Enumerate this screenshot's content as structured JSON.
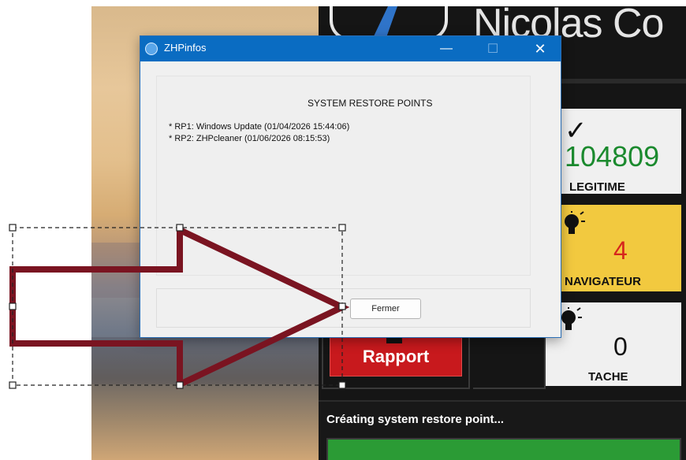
{
  "background_app": {
    "brand_text": "Nicolas Co",
    "tiles": [
      {
        "value": "104809",
        "label": "LEGITIME"
      },
      {
        "value": "4",
        "label": "NAVIGATEUR"
      },
      {
        "value": "0",
        "label": "TACHE"
      }
    ],
    "rapport_button": "Rapport",
    "status_text": "Créating system restore point...",
    "progress_fraction": 1.0,
    "colors": {
      "legit_green": "#1b8a2e",
      "nav_red": "#d6251c",
      "nav_tile": "#f2c93f",
      "rapport_red": "#c8191d",
      "progress_green": "#2b9b35"
    },
    "icons": [
      "check-icon",
      "bulb-icon",
      "bulb-icon"
    ]
  },
  "dialog": {
    "title": "ZHPinfos",
    "controls": {
      "minimize": "—",
      "maximize": "☐",
      "close": "✕"
    },
    "heading": "SYSTEM RESTORE POINTS",
    "restore_points": [
      "* RP1: Windows Update (01/04/2026 15:44:06)",
      "* RP2: ZHPcleaner (01/06/2026 08:15:53)"
    ],
    "close_button": "Fermer",
    "accent": "#0a6cc2"
  },
  "annotation": {
    "shape": "arrow-pointing-right",
    "color": "#7a1421",
    "selected": true
  }
}
